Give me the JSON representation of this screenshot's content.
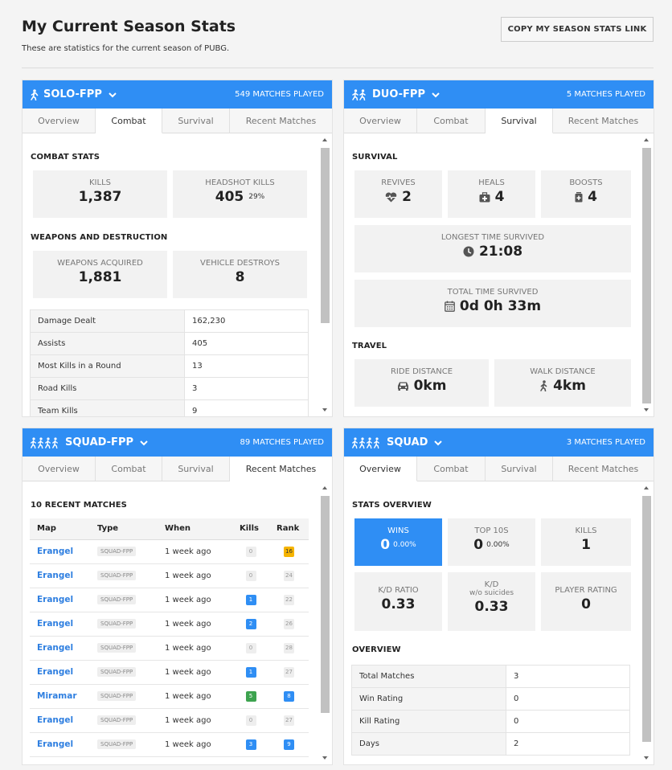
{
  "header": {
    "title": "My Current Season Stats",
    "subtitle": "These are statistics for the current season of PUBG.",
    "copy_button": "COPY MY SEASON STATS LINK"
  },
  "cards": [
    {
      "mode": "SOLO-FPP",
      "matches": "549 MATCHES PLAYED",
      "tabs": [
        "Overview",
        "Combat",
        "Survival",
        "Recent Matches"
      ],
      "active_tab": "Combat",
      "sections": {
        "combat_title": "COMBAT STATS",
        "kills_label": "KILLS",
        "kills_value": "1,387",
        "headshot_label": "HEADSHOT KILLS",
        "headshot_value": "405",
        "headshot_pct": "29%",
        "weapons_title": "WEAPONS AND DESTRUCTION",
        "weapons_label": "WEAPONS ACQUIRED",
        "weapons_value": "1,881",
        "vehicle_label": "VEHICLE DESTROYS",
        "vehicle_value": "8"
      },
      "table": [
        {
          "k": "Damage Dealt",
          "v": "162,230"
        },
        {
          "k": "Assists",
          "v": "405"
        },
        {
          "k": "Most Kills in a Round",
          "v": "13"
        },
        {
          "k": "Road Kills",
          "v": "3"
        },
        {
          "k": "Team Kills",
          "v": "9"
        }
      ]
    },
    {
      "mode": "DUO-FPP",
      "matches": "5 MATCHES PLAYED",
      "tabs": [
        "Overview",
        "Combat",
        "Survival",
        "Recent Matches"
      ],
      "active_tab": "Survival",
      "sections": {
        "survival_title": "SURVIVAL",
        "revives_label": "REVIVES",
        "revives_value": "2",
        "heals_label": "HEALS",
        "heals_value": "4",
        "boosts_label": "BOOSTS",
        "boosts_value": "4",
        "longest_label": "LONGEST TIME SURVIVED",
        "longest_value": "21:08",
        "total_label": "TOTAL TIME SURVIVED",
        "total_value": "0d 0h 33m",
        "travel_title": "TRAVEL",
        "ride_label": "RIDE DISTANCE",
        "ride_value": "0km",
        "walk_label": "WALK DISTANCE",
        "walk_value": "4km"
      }
    },
    {
      "mode": "SQUAD-FPP",
      "matches": "89 MATCHES PLAYED",
      "tabs": [
        "Overview",
        "Combat",
        "Survival",
        "Recent Matches"
      ],
      "active_tab": "Recent Matches",
      "sections": {
        "recent_title": "10 RECENT MATCHES",
        "columns": [
          "Map",
          "Type",
          "When",
          "Kills",
          "Rank"
        ]
      },
      "rows": [
        {
          "map": "Erangel",
          "type": "SQUAD-FPP",
          "when": "1 week ago",
          "kills": "0",
          "rank": "16"
        },
        {
          "map": "Erangel",
          "type": "SQUAD-FPP",
          "when": "1 week ago",
          "kills": "0",
          "rank": "24"
        },
        {
          "map": "Erangel",
          "type": "SQUAD-FPP",
          "when": "1 week ago",
          "kills": "1",
          "rank": "22"
        },
        {
          "map": "Erangel",
          "type": "SQUAD-FPP",
          "when": "1 week ago",
          "kills": "2",
          "rank": "26"
        },
        {
          "map": "Erangel",
          "type": "SQUAD-FPP",
          "when": "1 week ago",
          "kills": "0",
          "rank": "28"
        },
        {
          "map": "Erangel",
          "type": "SQUAD-FPP",
          "when": "1 week ago",
          "kills": "1",
          "rank": "27"
        },
        {
          "map": "Miramar",
          "type": "SQUAD-FPP",
          "when": "1 week ago",
          "kills": "5",
          "rank": "8"
        },
        {
          "map": "Erangel",
          "type": "SQUAD-FPP",
          "when": "1 week ago",
          "kills": "0",
          "rank": "27"
        },
        {
          "map": "Erangel",
          "type": "SQUAD-FPP",
          "when": "1 week ago",
          "kills": "3",
          "rank": "9"
        }
      ]
    },
    {
      "mode": "SQUAD",
      "matches": "3 MATCHES PLAYED",
      "tabs": [
        "Overview",
        "Combat",
        "Survival",
        "Recent Matches"
      ],
      "active_tab": "Overview",
      "sections": {
        "stats_title": "STATS OVERVIEW",
        "wins_label": "WINS",
        "wins_value": "0",
        "wins_pct": "0.00%",
        "top10_label": "TOP 10S",
        "top10_value": "0",
        "top10_pct": "0.00%",
        "kills_label": "KILLS",
        "kills_value": "1",
        "kd_label": "K/D RATIO",
        "kd_value": "0.33",
        "kdws_label": "K/D",
        "kdws_sub": "w/o suicides",
        "kdws_value": "0.33",
        "rating_label": "PLAYER RATING",
        "rating_value": "0",
        "overview_title": "OVERVIEW"
      },
      "table": [
        {
          "k": "Total Matches",
          "v": "3"
        },
        {
          "k": "Win Rating",
          "v": "0"
        },
        {
          "k": "Kill Rating",
          "v": "0"
        },
        {
          "k": "Days",
          "v": "2"
        }
      ]
    }
  ],
  "colors": {
    "accent": "#2f8ef4",
    "green": "#3da34f",
    "gold": "#f6b400"
  }
}
